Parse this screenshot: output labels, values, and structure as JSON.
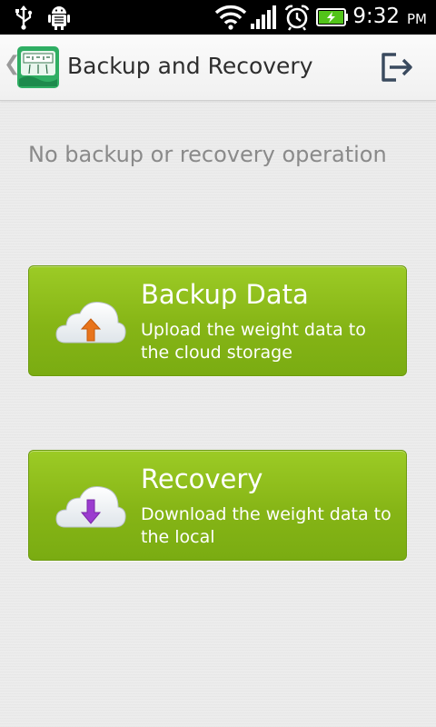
{
  "status_bar": {
    "time": "9:32",
    "ampm": "PM",
    "icons": [
      "usb-icon",
      "android-debug-icon",
      "wifi-icon",
      "signal-icon",
      "alarm-icon",
      "battery-charging-icon"
    ]
  },
  "header": {
    "title": "Backup and Recovery",
    "back_icon": "chevron-left-icon",
    "logo_icon": "scale-icon",
    "action_icon": "exit-icon"
  },
  "main": {
    "status_message": "No backup or recovery operation",
    "actions": [
      {
        "title": "Backup Data",
        "description": "Upload the weight data to the cloud storage",
        "icon": "cloud-upload-icon"
      },
      {
        "title": "Recovery",
        "description": "Download the weight data to the local",
        "icon": "cloud-download-icon"
      }
    ]
  },
  "colors": {
    "card_green": "#8dbd1b",
    "upload_arrow": "#e8741c",
    "download_arrow": "#9b3ccf"
  }
}
